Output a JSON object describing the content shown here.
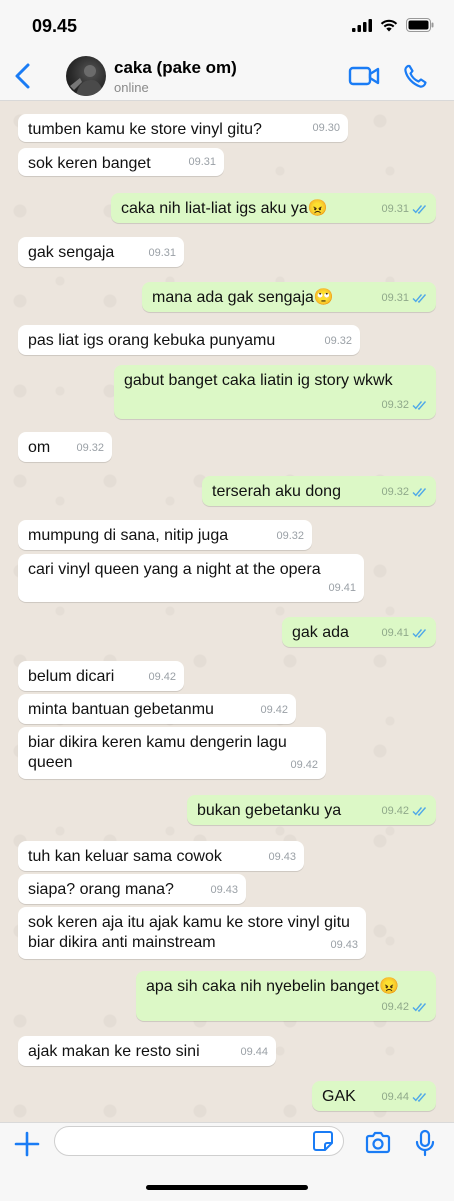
{
  "status_bar": {
    "time": "09.45"
  },
  "header": {
    "contact_name": "caka (pake om)",
    "status": "online"
  },
  "messages": [
    {
      "text": "tumben kamu ke store vinyl gitu?",
      "time": "09.30",
      "dir": "in"
    },
    {
      "text": "sok keren banget",
      "time": "09.31",
      "dir": "in"
    },
    {
      "text": "caka nih liat-liat igs aku ya😠",
      "time": "09.31",
      "dir": "out"
    },
    {
      "text": "gak sengaja",
      "time": "09.31",
      "dir": "in"
    },
    {
      "text": "mana ada gak sengaja🙄",
      "time": "09.31",
      "dir": "out"
    },
    {
      "text": "pas liat igs orang kebuka punyamu",
      "time": "09.32",
      "dir": "in"
    },
    {
      "text": "gabut banget caka liatin ig story wkwk",
      "time": "09.32",
      "dir": "out"
    },
    {
      "text": "om",
      "time": "09.32",
      "dir": "in"
    },
    {
      "text": "terserah aku dong",
      "time": "09.32",
      "dir": "out"
    },
    {
      "text": "mumpung di sana, nitip juga",
      "time": "09.32",
      "dir": "in"
    },
    {
      "text": "cari vinyl queen yang a night at the opera",
      "time": "09.41",
      "dir": "in"
    },
    {
      "text": "gak ada",
      "time": "09.41",
      "dir": "out"
    },
    {
      "text": "belum dicari",
      "time": "09.42",
      "dir": "in"
    },
    {
      "text": "minta bantuan gebetanmu",
      "time": "09.42",
      "dir": "in"
    },
    {
      "text": "biar dikira keren kamu dengerin lagu queen",
      "time": "09.42",
      "dir": "in"
    },
    {
      "text": "bukan gebetanku ya",
      "time": "09.42",
      "dir": "out"
    },
    {
      "text": "tuh kan keluar sama cowok",
      "time": "09.43",
      "dir": "in"
    },
    {
      "text": "siapa? orang mana?",
      "time": "09.43",
      "dir": "in"
    },
    {
      "text": "sok keren aja itu ajak kamu ke store vinyl gitu biar dikira anti mainstream",
      "time": "09.43",
      "dir": "in"
    },
    {
      "text": "apa sih caka nih nyebelin banget😠",
      "time": "09.42",
      "dir": "out"
    },
    {
      "text": "ajak makan ke resto sini",
      "time": "09.44",
      "dir": "in"
    },
    {
      "text": "GAK",
      "time": "09.44",
      "dir": "out"
    }
  ],
  "input": {
    "placeholder": ""
  },
  "colors": {
    "accent": "#1a7cf5",
    "outgoing_bubble": "#dcf8c6",
    "incoming_bubble": "#ffffff",
    "read_ticks": "#4fa8e8"
  }
}
